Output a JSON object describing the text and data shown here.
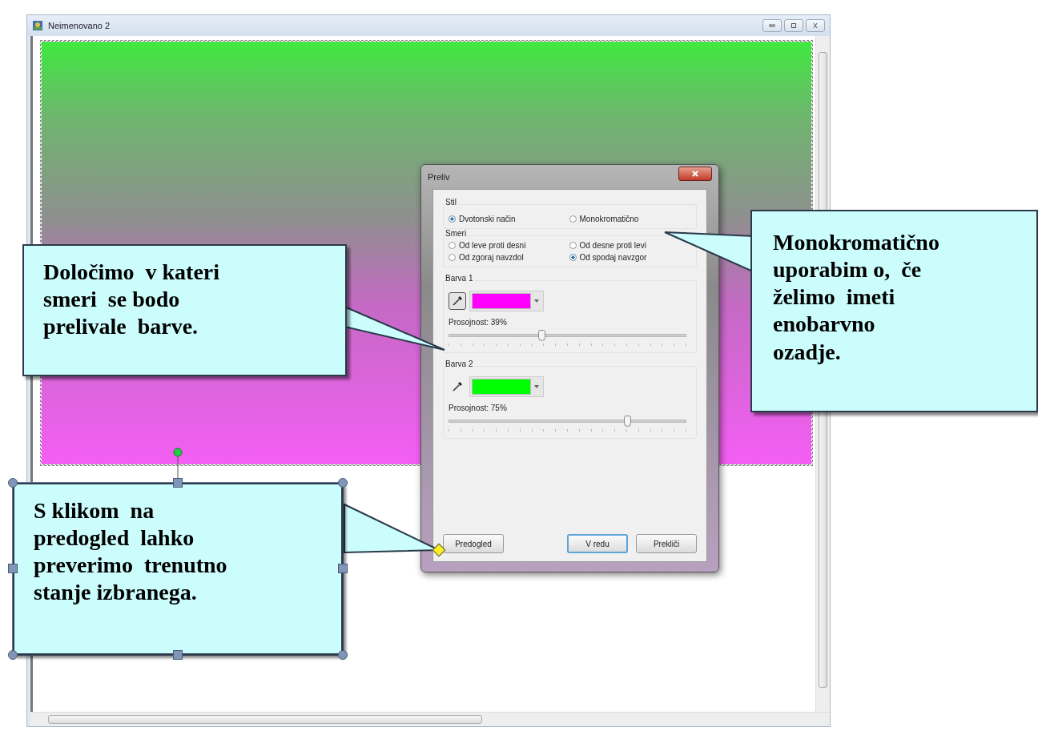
{
  "window": {
    "title": "Neimenovano 2"
  },
  "dialog": {
    "title": "Preliv",
    "style": {
      "label": "Stil",
      "options": [
        {
          "label": "Dvotonski način",
          "selected": true
        },
        {
          "label": "Monokromatično",
          "selected": false
        }
      ]
    },
    "directions": {
      "label": "Smeri",
      "options": [
        {
          "label": "Od leve proti desni",
          "selected": false
        },
        {
          "label": "Od desne proti levi",
          "selected": false
        },
        {
          "label": "Od zgoraj navzdol",
          "selected": false
        },
        {
          "label": "Od spodaj navzgor",
          "selected": true
        }
      ]
    },
    "colors": [
      {
        "label": "Barva 1",
        "color": "#ff00ff",
        "picker_pressed": true,
        "opacity": "Prosojnost: 39%",
        "level": 0.39
      },
      {
        "label": "Barva 2",
        "color": "#00ff00",
        "picker_pressed": false,
        "opacity": "Prosojnost: 75%",
        "level": 0.75
      }
    ],
    "buttons": [
      {
        "label": "Predogled",
        "default": false
      },
      {
        "label": "V redu",
        "default": true
      },
      {
        "label": "Prekliči",
        "default": false
      }
    ]
  },
  "callouts": [
    {
      "text": "Določimo  v kateri\nsmeri  se bodo\nprelivale  barve.",
      "selected": false
    },
    {
      "text": "Monokromatično\nuporabim o,  če\nželimo  imeti\nenobarvno\nozadje.",
      "selected": false
    },
    {
      "text": "S klikom  na\npredogled  lahko\npreverimo  trenutno\nstanje izbranega.",
      "selected": true
    }
  ]
}
